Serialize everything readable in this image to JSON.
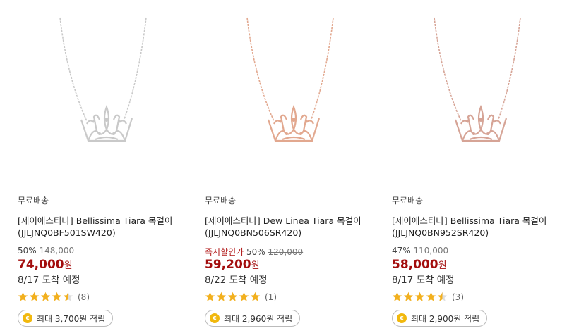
{
  "products": [
    {
      "shipping": "무료배송",
      "title_line1": "[제이에스티나] Bellissima Tiara 목걸이",
      "title_line2": "(JJLJNQ0BF501SW420)",
      "promo_label": "",
      "discount": "50%",
      "original_price": "148,000",
      "price": "74,000",
      "currency": "원",
      "arrival": "8/17 도착 예정",
      "rating": 4.5,
      "review_count": "(8)",
      "points": "최대 3,700원 적립",
      "metal_color": "#c9c9c9"
    },
    {
      "shipping": "무료배송",
      "title_line1": "[제이에스티나] Dew Linea Tiara 목걸이",
      "title_line2": "(JJLJNQ0BN506SR420)",
      "promo_label": "즉시할인가",
      "discount": "50%",
      "original_price": "120,000",
      "price": "59,200",
      "currency": "원",
      "arrival": "8/22 도착 예정",
      "rating": 5,
      "review_count": "(1)",
      "points": "최대 2,960원 적립",
      "metal_color": "#e2a88f"
    },
    {
      "shipping": "무료배송",
      "title_line1": "[제이에스티나] Bellissima Tiara 목걸이",
      "title_line2": "(JJLJNQ0BN952SR420)",
      "promo_label": "",
      "discount": "47%",
      "original_price": "110,000",
      "price": "58,000",
      "currency": "원",
      "arrival": "8/17 도착 예정",
      "rating": 4.5,
      "review_count": "(3)",
      "points": "최대 2,900원 적립",
      "metal_color": "#d6a496"
    }
  ],
  "coin_glyph": "c",
  "colors": {
    "price": "#a30d0d",
    "star": "#f2b01e",
    "coin": "#f1b80d"
  }
}
